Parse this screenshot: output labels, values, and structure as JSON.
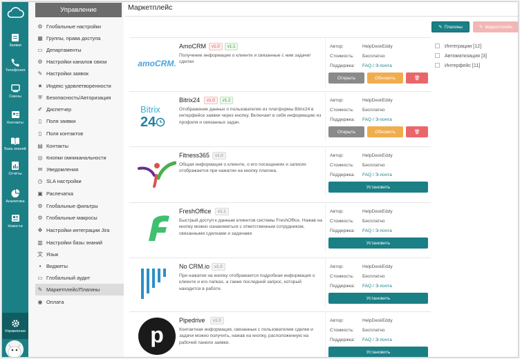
{
  "rail": {
    "items": [
      {
        "label": "Заявки",
        "icon": "tickets-icon"
      },
      {
        "label": "Телефония",
        "icon": "phone-icon"
      },
      {
        "label": "Смены",
        "icon": "shifts-icon"
      },
      {
        "label": "Контакты",
        "icon": "contacts-icon"
      },
      {
        "label": "База знаний",
        "icon": "knowledge-base-icon"
      },
      {
        "label": "Отчёты",
        "icon": "reports-icon"
      },
      {
        "label": "Аналитика",
        "icon": "analytics-icon"
      },
      {
        "label": "Новости",
        "icon": "news-icon"
      },
      {
        "label": "Управление",
        "icon": "settings-gear-icon"
      }
    ]
  },
  "nav": {
    "header": "Управление",
    "items": [
      {
        "label": "Глобальные настройки"
      },
      {
        "label": "Группы, права доступа"
      },
      {
        "label": "Департаменты"
      },
      {
        "label": "Настройки каналов связи"
      },
      {
        "label": "Настройки заявок"
      },
      {
        "label": "Индекс удовлетворенности"
      },
      {
        "label": "Безопасность/Авторизация"
      },
      {
        "label": "Диспетчер"
      },
      {
        "label": "Поля заявки"
      },
      {
        "label": "Поля контактов"
      },
      {
        "label": "Контакты"
      },
      {
        "label": "Кнопки омниканальности"
      },
      {
        "label": "Уведомления"
      },
      {
        "label": "SLA настройки"
      },
      {
        "label": "Распечатка"
      },
      {
        "label": "Глобальные фильтры"
      },
      {
        "label": "Глобальные макросы"
      },
      {
        "label": "Настройки интеграции Jira"
      },
      {
        "label": "Настройки базы знаний"
      },
      {
        "label": "Язык"
      },
      {
        "label": "Виджеты"
      },
      {
        "label": "Глобальный аудит"
      },
      {
        "label": "Маркетплейс/Плагины"
      },
      {
        "label": "Оплата"
      }
    ]
  },
  "main": {
    "title": "Маркетплейс",
    "plugins_button": "Плагины",
    "marketplace_button": "Маркетплейс",
    "filters": [
      "Интеграции [12]",
      "Автоматизация [3]",
      "Интерфейс [11]"
    ],
    "labels": {
      "author": "Автор:",
      "cost": "Стоимость:",
      "support": "Поддержка:",
      "open": "Открыть",
      "update": "Обновить",
      "install": "Установить"
    },
    "plugins": [
      {
        "name": "AmoCRM",
        "versions": [
          "v1.0",
          "v1.1"
        ],
        "description": "Получение информации о клиенте и связанные с ним задачи/сделки",
        "author": "HelpDeskEddy",
        "cost": "Бесплатно",
        "support": "FAQ / Э-почта",
        "installed": true,
        "logo_text": "amoCRM."
      },
      {
        "name": "Bitrix24",
        "versions": [
          "v1.0",
          "v1.2"
        ],
        "description": "Отображение данных о пользователях из платформы Bitrix24 в интерфейсе заявки через кнопку. Включает в себя информацию из профиля и связанных задач.",
        "author": "HelpDeskEddy",
        "cost": "Бесплатно",
        "support": "FAQ / Э-почта",
        "installed": true,
        "logo_text": "Bitrix",
        "logo_text_2": "24"
      },
      {
        "name": "Fitness365",
        "versions": [
          "v1.0"
        ],
        "description": "Общая информация о клиенте, о его посещениях и записях отображается при нажатии на кнопку плагина.",
        "author": "HelpDeskEddy",
        "cost": "Бесплатно",
        "support": "FAQ / Э-почта",
        "installed": false
      },
      {
        "name": "FreshOffice",
        "versions": [
          "v1.1"
        ],
        "description": "Быстрый доступ к данным клиентов системы FreshOffice. Нажав на кнопку можно ознакомиться с ответственным сотрудником, связанными сделками и задачами",
        "author": "HelpDeskEddy",
        "cost": "Бесплатно",
        "support": "FAQ / Э-почта",
        "installed": false
      },
      {
        "name": "No CRM.io",
        "versions": [
          "v1.0"
        ],
        "description": "При нажатии на кнопку отображается подробная информация о клиенте и его папках, а также последний запрос, который находится в работе.",
        "author": "HelpDeskEddy",
        "cost": "Бесплатно",
        "support": "FAQ / Э-почта",
        "installed": false
      },
      {
        "name": "Pipedrive",
        "versions": [
          "v1.0"
        ],
        "description": "Контактная информация, связанные с пользователем сделки и задачи можно получить, нажав на кнопку, расположенную на рабочей панели заявки.",
        "author": "HelpDeskEddy",
        "cost": "Бесплатно",
        "support": "FAQ / Э-почта",
        "installed": false,
        "logo_text": "p"
      }
    ]
  },
  "colors": {
    "brand": "#1b7f86",
    "update": "#f0ad4e",
    "delete": "#e9676a",
    "open": "#8a8a8a"
  }
}
